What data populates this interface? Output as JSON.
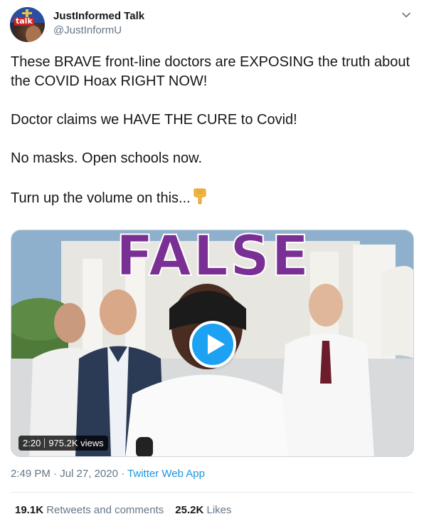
{
  "author": {
    "name": "JustInformed Talk",
    "handle": "@JustInformU",
    "avatar_text": "talk"
  },
  "tweet": {
    "paragraphs": [
      "These BRAVE front-line doctors are EXPOSING the truth about the COVID Hoax RIGHT NOW!",
      "Doctor claims we HAVE THE CURE to Covid!",
      "No masks. Open schools now."
    ],
    "last_line": "Turn up the volume on this...",
    "emoji": "pointing-down-hand-icon"
  },
  "media": {
    "overlay_label": "FALSE",
    "duration": "2:20",
    "views": "975.2K views"
  },
  "meta": {
    "time": "2:49 PM",
    "separator": "·",
    "date": "Jul 27, 2020",
    "source": "Twitter Web App"
  },
  "stats": {
    "retweets_count": "19.1K",
    "retweets_label": "Retweets and comments",
    "likes_count": "25.2K",
    "likes_label": "Likes"
  },
  "colors": {
    "link": "#1b95e0",
    "play_button": "#1da1f2",
    "false_label": "#7a2f95",
    "secondary_text": "#657786"
  }
}
